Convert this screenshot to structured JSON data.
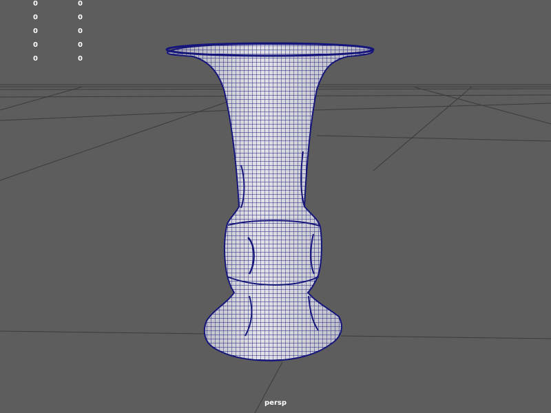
{
  "viewport": {
    "camera_name": "persp",
    "background_color": "#5d5d5d",
    "grid_color": "#3d3d3d",
    "wire_color": "#16167a",
    "surface_color": "#cfcfd6"
  },
  "hud": {
    "rows": [
      {
        "a": "0",
        "b": "0"
      },
      {
        "a": "0",
        "b": "0"
      },
      {
        "a": "0",
        "b": "0"
      },
      {
        "a": "0",
        "b": "0"
      },
      {
        "a": "0",
        "b": "0"
      }
    ]
  },
  "object": {
    "type": "vase-mesh",
    "display": "wireframe-on-shaded"
  }
}
